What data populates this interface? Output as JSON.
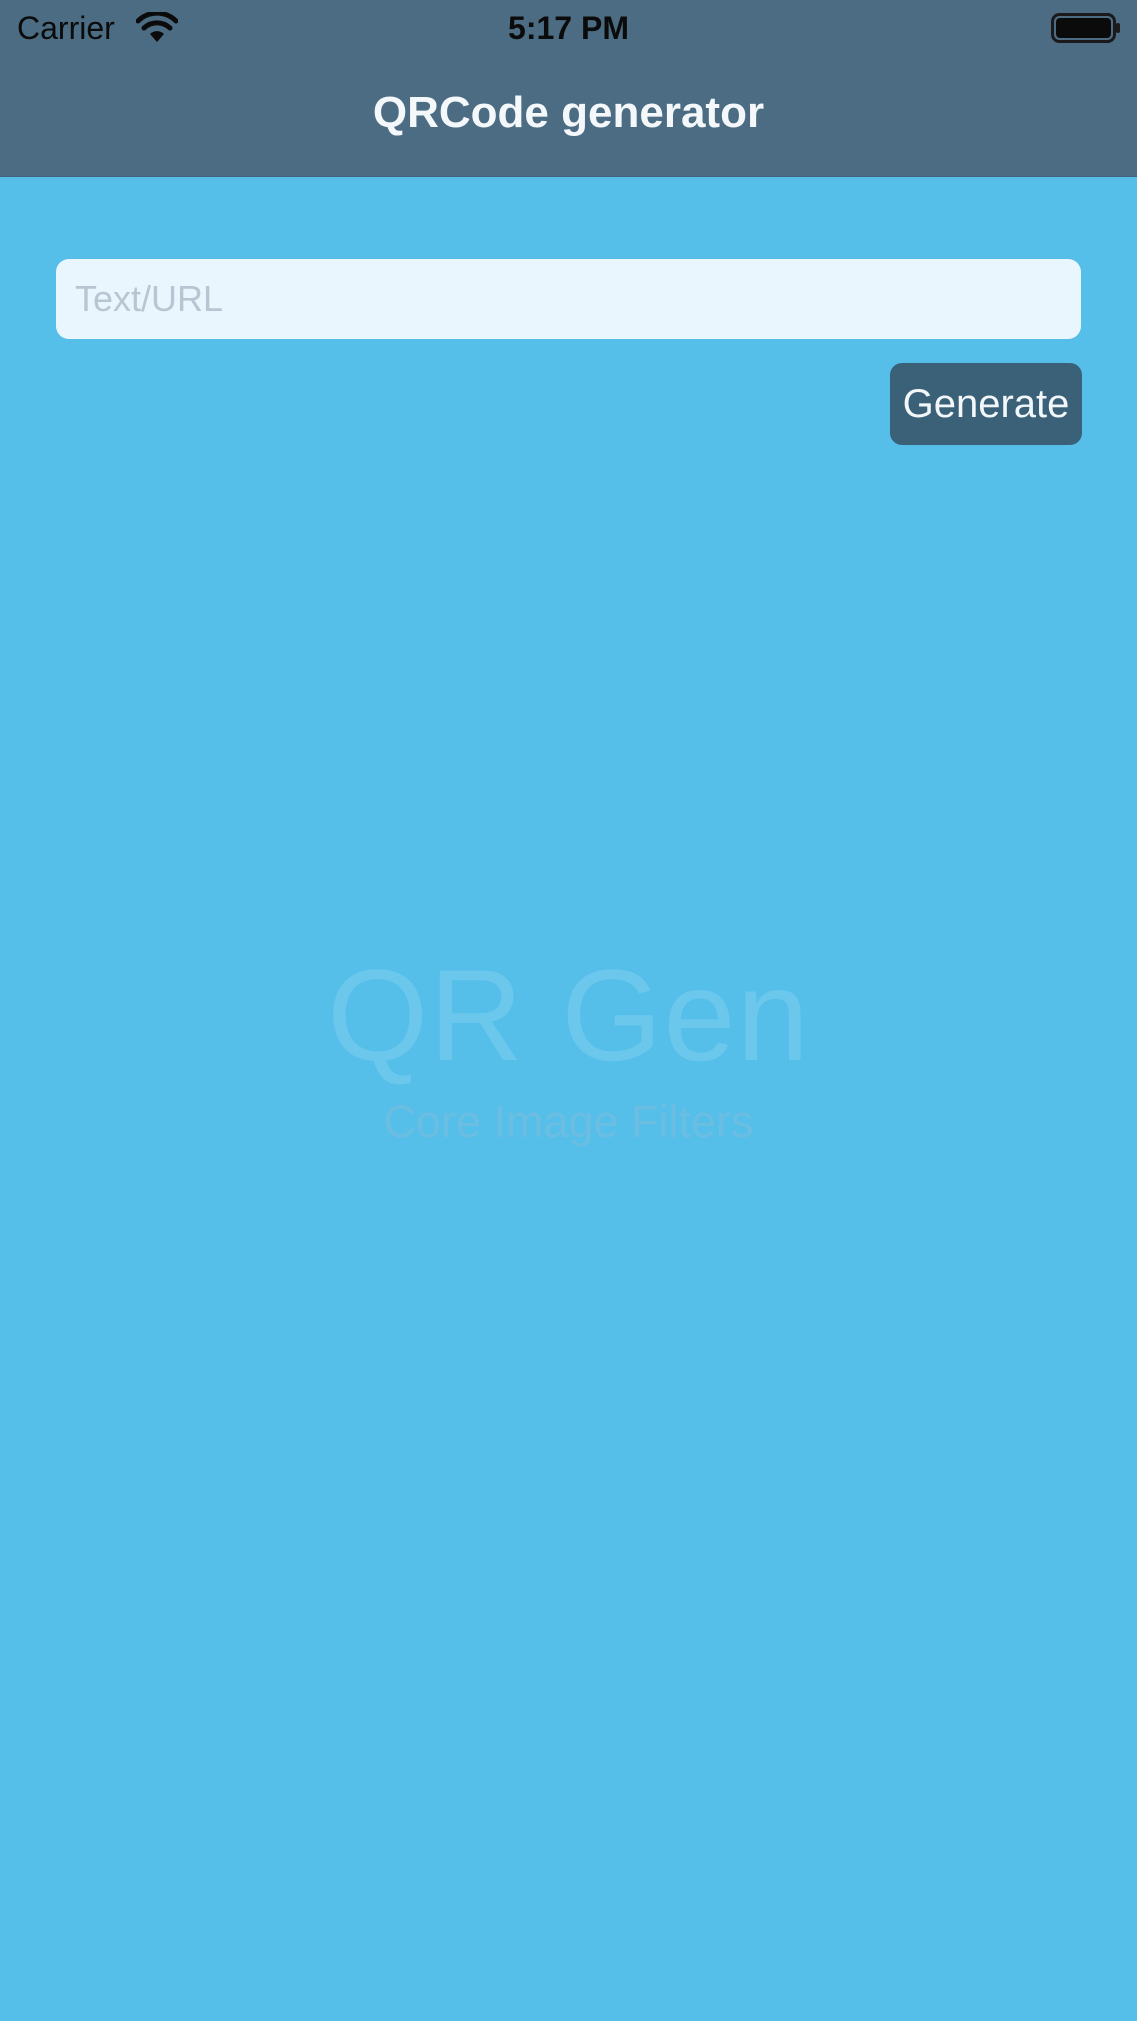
{
  "status_bar": {
    "carrier": "Carrier",
    "time": "5:17 PM",
    "wifi_icon": "wifi-icon",
    "battery_icon": "battery-full-icon"
  },
  "nav": {
    "title": "QRCode generator"
  },
  "form": {
    "input_placeholder": "Text/URL",
    "input_value": "",
    "generate_label": "Generate"
  },
  "watermark": {
    "title": "QR Gen",
    "subtitle": "Core Image Filters"
  },
  "colors": {
    "background": "#55bfe9",
    "nav_bar": "#4b6c82",
    "input_background": "#eaf6fe",
    "button_background": "#3b6179",
    "button_text": "#f2f7fa"
  }
}
